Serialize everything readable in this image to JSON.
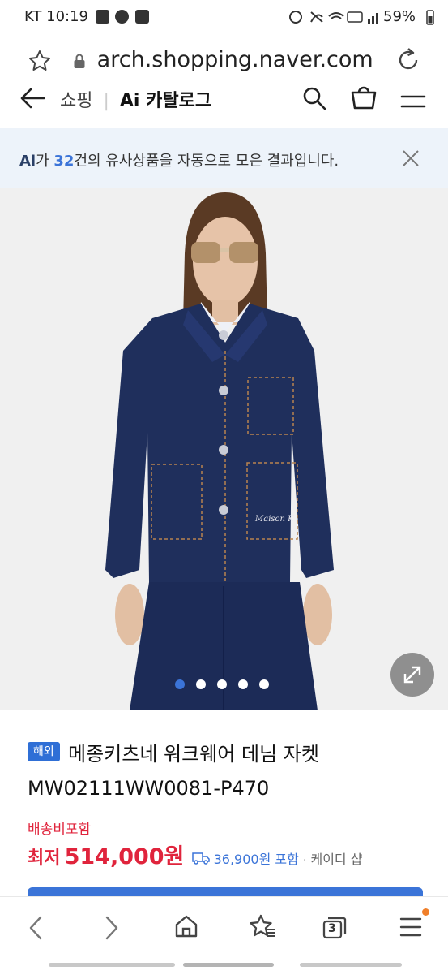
{
  "status_bar": {
    "carrier_time": "KT 10:19",
    "battery": "59%"
  },
  "url_bar": {
    "url": "search.shopping.naver.com"
  },
  "header": {
    "section": "쇼핑",
    "separator": "|",
    "catalog": "Ai 카탈로그"
  },
  "ai_banner": {
    "badge": "Ai",
    "text_pre": "가 ",
    "count": "32",
    "text_post": "건의 유사상품을 자동으로 모은 결과입니다."
  },
  "carousel": {
    "slide_count": 5,
    "active_index": 0
  },
  "product": {
    "badge": "해외",
    "title": "메종키츠네 워크웨어 데님 자켓 MW02111WW0081-P470",
    "shipping_label": "배송비포함",
    "price_prefix": "최저",
    "price": "514,000원",
    "shipping_fee": "36,900원 포함",
    "seller": "케이디 샵"
  },
  "bottom_nav": {
    "tab_count": "3"
  },
  "colors": {
    "accent_blue": "#3b74d8",
    "price_red": "#e0243c",
    "banner_bg": "#edf3fa",
    "denim": "#1f2f5c"
  }
}
